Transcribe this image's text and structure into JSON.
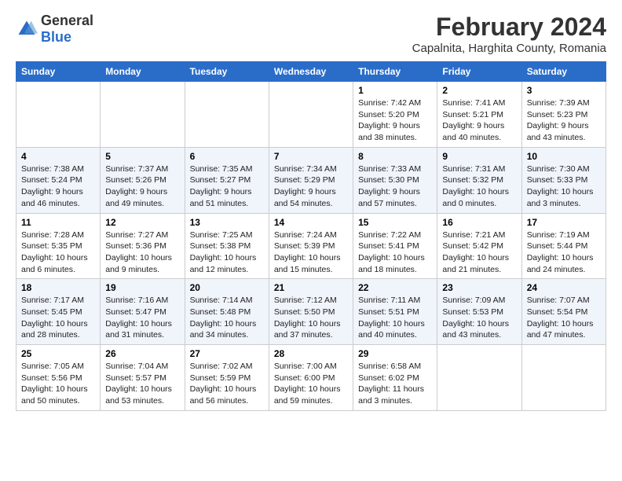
{
  "header": {
    "logo_general": "General",
    "logo_blue": "Blue",
    "title": "February 2024",
    "subtitle": "Capalnita, Harghita County, Romania"
  },
  "columns": [
    "Sunday",
    "Monday",
    "Tuesday",
    "Wednesday",
    "Thursday",
    "Friday",
    "Saturday"
  ],
  "weeks": [
    [
      {
        "num": "",
        "info": ""
      },
      {
        "num": "",
        "info": ""
      },
      {
        "num": "",
        "info": ""
      },
      {
        "num": "",
        "info": ""
      },
      {
        "num": "1",
        "info": "Sunrise: 7:42 AM\nSunset: 5:20 PM\nDaylight: 9 hours\nand 38 minutes."
      },
      {
        "num": "2",
        "info": "Sunrise: 7:41 AM\nSunset: 5:21 PM\nDaylight: 9 hours\nand 40 minutes."
      },
      {
        "num": "3",
        "info": "Sunrise: 7:39 AM\nSunset: 5:23 PM\nDaylight: 9 hours\nand 43 minutes."
      }
    ],
    [
      {
        "num": "4",
        "info": "Sunrise: 7:38 AM\nSunset: 5:24 PM\nDaylight: 9 hours\nand 46 minutes."
      },
      {
        "num": "5",
        "info": "Sunrise: 7:37 AM\nSunset: 5:26 PM\nDaylight: 9 hours\nand 49 minutes."
      },
      {
        "num": "6",
        "info": "Sunrise: 7:35 AM\nSunset: 5:27 PM\nDaylight: 9 hours\nand 51 minutes."
      },
      {
        "num": "7",
        "info": "Sunrise: 7:34 AM\nSunset: 5:29 PM\nDaylight: 9 hours\nand 54 minutes."
      },
      {
        "num": "8",
        "info": "Sunrise: 7:33 AM\nSunset: 5:30 PM\nDaylight: 9 hours\nand 57 minutes."
      },
      {
        "num": "9",
        "info": "Sunrise: 7:31 AM\nSunset: 5:32 PM\nDaylight: 10 hours\nand 0 minutes."
      },
      {
        "num": "10",
        "info": "Sunrise: 7:30 AM\nSunset: 5:33 PM\nDaylight: 10 hours\nand 3 minutes."
      }
    ],
    [
      {
        "num": "11",
        "info": "Sunrise: 7:28 AM\nSunset: 5:35 PM\nDaylight: 10 hours\nand 6 minutes."
      },
      {
        "num": "12",
        "info": "Sunrise: 7:27 AM\nSunset: 5:36 PM\nDaylight: 10 hours\nand 9 minutes."
      },
      {
        "num": "13",
        "info": "Sunrise: 7:25 AM\nSunset: 5:38 PM\nDaylight: 10 hours\nand 12 minutes."
      },
      {
        "num": "14",
        "info": "Sunrise: 7:24 AM\nSunset: 5:39 PM\nDaylight: 10 hours\nand 15 minutes."
      },
      {
        "num": "15",
        "info": "Sunrise: 7:22 AM\nSunset: 5:41 PM\nDaylight: 10 hours\nand 18 minutes."
      },
      {
        "num": "16",
        "info": "Sunrise: 7:21 AM\nSunset: 5:42 PM\nDaylight: 10 hours\nand 21 minutes."
      },
      {
        "num": "17",
        "info": "Sunrise: 7:19 AM\nSunset: 5:44 PM\nDaylight: 10 hours\nand 24 minutes."
      }
    ],
    [
      {
        "num": "18",
        "info": "Sunrise: 7:17 AM\nSunset: 5:45 PM\nDaylight: 10 hours\nand 28 minutes."
      },
      {
        "num": "19",
        "info": "Sunrise: 7:16 AM\nSunset: 5:47 PM\nDaylight: 10 hours\nand 31 minutes."
      },
      {
        "num": "20",
        "info": "Sunrise: 7:14 AM\nSunset: 5:48 PM\nDaylight: 10 hours\nand 34 minutes."
      },
      {
        "num": "21",
        "info": "Sunrise: 7:12 AM\nSunset: 5:50 PM\nDaylight: 10 hours\nand 37 minutes."
      },
      {
        "num": "22",
        "info": "Sunrise: 7:11 AM\nSunset: 5:51 PM\nDaylight: 10 hours\nand 40 minutes."
      },
      {
        "num": "23",
        "info": "Sunrise: 7:09 AM\nSunset: 5:53 PM\nDaylight: 10 hours\nand 43 minutes."
      },
      {
        "num": "24",
        "info": "Sunrise: 7:07 AM\nSunset: 5:54 PM\nDaylight: 10 hours\nand 47 minutes."
      }
    ],
    [
      {
        "num": "25",
        "info": "Sunrise: 7:05 AM\nSunset: 5:56 PM\nDaylight: 10 hours\nand 50 minutes."
      },
      {
        "num": "26",
        "info": "Sunrise: 7:04 AM\nSunset: 5:57 PM\nDaylight: 10 hours\nand 53 minutes."
      },
      {
        "num": "27",
        "info": "Sunrise: 7:02 AM\nSunset: 5:59 PM\nDaylight: 10 hours\nand 56 minutes."
      },
      {
        "num": "28",
        "info": "Sunrise: 7:00 AM\nSunset: 6:00 PM\nDaylight: 10 hours\nand 59 minutes."
      },
      {
        "num": "29",
        "info": "Sunrise: 6:58 AM\nSunset: 6:02 PM\nDaylight: 11 hours\nand 3 minutes."
      },
      {
        "num": "",
        "info": ""
      },
      {
        "num": "",
        "info": ""
      }
    ]
  ]
}
